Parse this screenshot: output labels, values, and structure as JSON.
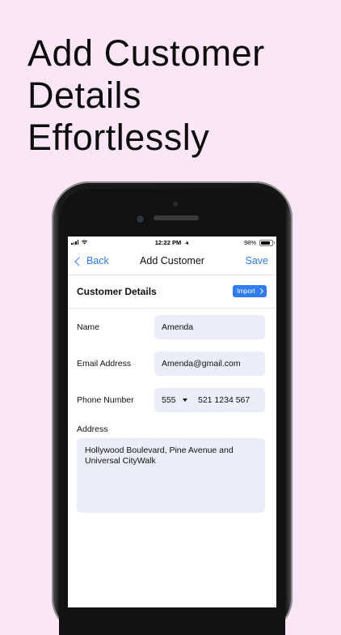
{
  "headline": {
    "line1": "Add Customer",
    "line2": "Details",
    "line3": "Effortlessly"
  },
  "status_bar": {
    "time": "12:22 PM",
    "battery": "98%"
  },
  "navbar": {
    "back_label": "Back",
    "title": "Add Customer",
    "save_label": "Save"
  },
  "section": {
    "title": "Customer Details",
    "import_label": "Import"
  },
  "form": {
    "name_label": "Name",
    "name_value": "Amenda",
    "email_label": "Email Address",
    "email_value": "Amenda@gmail.com",
    "phone_label": "Phone Number",
    "phone_country_code": "555",
    "phone_value": "521 1234 567",
    "address_label": "Address",
    "address_value": "Hollywood Boulevard, Pine Avenue and Universal CityWalk"
  },
  "colors": {
    "background": "#fbe6f7",
    "accent": "#2f7cf6",
    "field": "#ebeef8"
  }
}
